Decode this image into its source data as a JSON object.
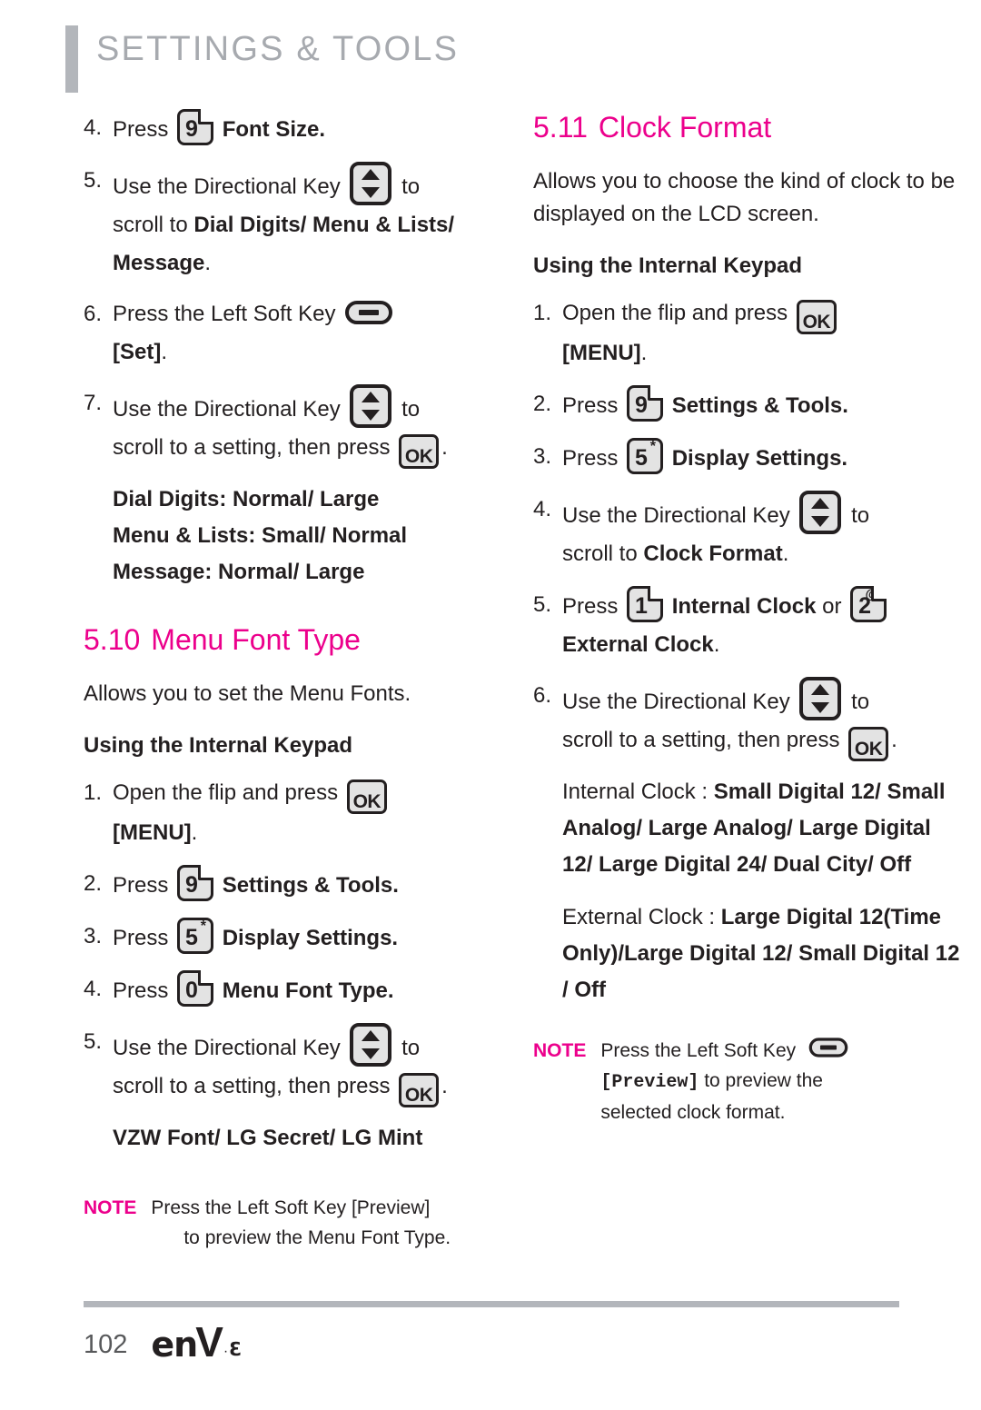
{
  "header": {
    "title": "SETTINGS & TOOLS"
  },
  "left_column": {
    "continued_steps": [
      {
        "num": "4.",
        "pre": "Press",
        "icon": "key-9",
        "post": "Font Size.",
        "post_bold": true
      },
      {
        "num": "5.",
        "pre": "Use the Directional Key",
        "icon": "directional-key",
        "post": "to",
        "line2_pre": "scroll to ",
        "line2_bold": "Dial Digits/ Menu & Lists/ Message",
        "line2_post": "."
      },
      {
        "num": "6.",
        "pre": "Press the Left Soft Key",
        "icon": "left-soft-key",
        "line2_bold": "[Set]",
        "line2_post": "."
      },
      {
        "num": "7.",
        "pre": "Use the Directional Key",
        "icon": "directional-key",
        "post": "to",
        "line2_pre": "scroll to a setting, then press",
        "line2_icon": "ok-key",
        "line2_post": "."
      }
    ],
    "font_size_options": [
      "Dial Digits: Normal/ Large",
      "Menu & Lists: Small/ Normal",
      "Message: Normal/ Large"
    ],
    "section": {
      "number": "5.10",
      "title": "Menu Font Type",
      "description": "Allows you to set the Menu Fonts.",
      "subhead": "Using the Internal Keypad"
    },
    "steps": [
      {
        "num": "1.",
        "pre": "Open the flip and press",
        "icon": "ok-key",
        "line2_bold": "[MENU]",
        "line2_post": "."
      },
      {
        "num": "2.",
        "pre": "Press",
        "icon": "key-9",
        "post": "Settings & Tools.",
        "post_bold": true
      },
      {
        "num": "3.",
        "pre": "Press",
        "icon": "key-5",
        "post": "Display Settings.",
        "post_bold": true
      },
      {
        "num": "4.",
        "pre": "Press",
        "icon": "key-0",
        "post": "Menu Font Type.",
        "post_bold": true
      },
      {
        "num": "5.",
        "pre": "Use the Directional Key",
        "icon": "directional-key",
        "post": "to",
        "line2_pre": "scroll to a setting, then press",
        "line2_icon": "ok-key",
        "line2_post": "."
      }
    ],
    "font_type_options": "VZW Font/ LG Secret/ LG Mint",
    "note": {
      "label": "NOTE",
      "line1": "Press the Left Soft Key [Preview]",
      "line2": "to preview the Menu Font Type."
    }
  },
  "right_column": {
    "section": {
      "number": "5.11",
      "title": "Clock Format",
      "description": "Allows you to choose the kind of clock to be displayed on the LCD screen.",
      "subhead": "Using the Internal Keypad"
    },
    "steps": [
      {
        "num": "1.",
        "pre": "Open the flip and press",
        "icon": "ok-key",
        "line2_bold": "[MENU]",
        "line2_post": "."
      },
      {
        "num": "2.",
        "pre": "Press",
        "icon": "key-9",
        "post": "Settings & Tools.",
        "post_bold": true
      },
      {
        "num": "3.",
        "pre": "Press",
        "icon": "key-5",
        "post": "Display Settings.",
        "post_bold": true
      },
      {
        "num": "4.",
        "pre": "Use the Directional Key",
        "icon": "directional-key",
        "post": "to",
        "line2_pre": "scroll to ",
        "line2_bold": "Clock Format",
        "line2_post": "."
      },
      {
        "num": "5.",
        "pre": "Press",
        "icon": "key-1",
        "mid_bold": "Internal Clock",
        "mid": "or",
        "icon2": "key-2",
        "line2_bold": "External Clock",
        "line2_post": "."
      },
      {
        "num": "6.",
        "pre": "Use the Directional Key",
        "icon": "directional-key",
        "post": "to",
        "line2_pre": "scroll to a setting, then press",
        "line2_icon": "ok-key",
        "line2_post": "."
      }
    ],
    "internal_clock": {
      "label": "Internal Clock : ",
      "values": "Small Digital 12/ Small Analog/ Large Analog/ Large Digital 12/ Large Digital 24/ Dual City/ Off"
    },
    "external_clock": {
      "label": "External Clock : ",
      "values": "Large Digital 12(Time Only)/Large Digital 12/ Small Digital 12 / Off"
    },
    "note": {
      "label": "NOTE",
      "line1_pre": "Press the Left Soft Key",
      "line1_icon": "left-soft-key",
      "line2_mono": "[Preview]",
      "line2_post": " to preview the",
      "line3": "selected clock format."
    }
  },
  "footer": {
    "page_number": "102",
    "logo_en": "en",
    "logo_v": "V",
    "logo_sup": "3"
  },
  "colors": {
    "accent_pink": "#ec008c",
    "header_gray": "#a7aaaf",
    "bar_gray": "#b3b6bb",
    "text": "#231f20"
  }
}
